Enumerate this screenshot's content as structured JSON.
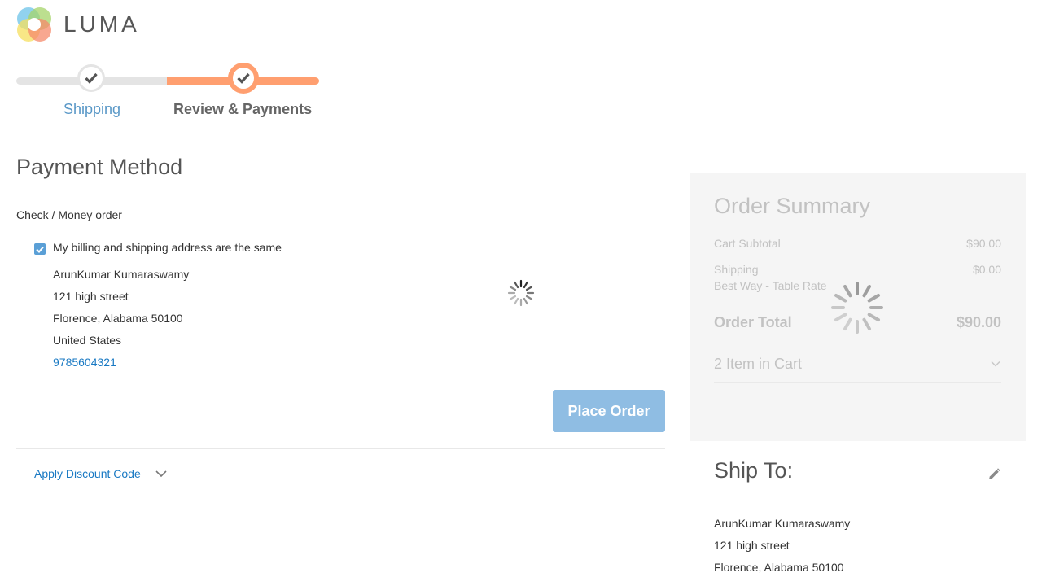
{
  "brand": {
    "name": "LUMA"
  },
  "progress": {
    "steps": [
      {
        "label": "Shipping",
        "state": "complete"
      },
      {
        "label": "Review & Payments",
        "state": "active"
      }
    ]
  },
  "payment": {
    "title": "Payment Method",
    "method": "Check / Money order",
    "same_address_label": "My billing and shipping address are the same",
    "same_address_checked": true,
    "address": {
      "name": "ArunKumar Kumaraswamy",
      "street": "121 high street",
      "city_line": "Florence, Alabama 50100",
      "country": "United States",
      "phone": "9785604321"
    },
    "place_order_label": "Place Order",
    "discount_label": "Apply Discount Code"
  },
  "summary": {
    "title": "Order Summary",
    "cart_subtotal_label": "Cart Subtotal",
    "cart_subtotal_value": "$90.00",
    "shipping_label": "Shipping",
    "shipping_value": "$0.00",
    "shipping_method": "Best Way - Table Rate",
    "order_total_label": "Order Total",
    "order_total_value": "$90.00",
    "items_in_cart": "2 Item in Cart"
  },
  "ship_to": {
    "title": "Ship To:",
    "name": "ArunKumar Kumaraswamy",
    "street": "121 high street",
    "city_line": "Florence, Alabama 50100"
  },
  "colors": {
    "accent_orange": "#ff9f70",
    "link_blue": "#1979c3",
    "button_blue": "#8fbde3",
    "checkbox_blue": "#5a9fd6"
  }
}
